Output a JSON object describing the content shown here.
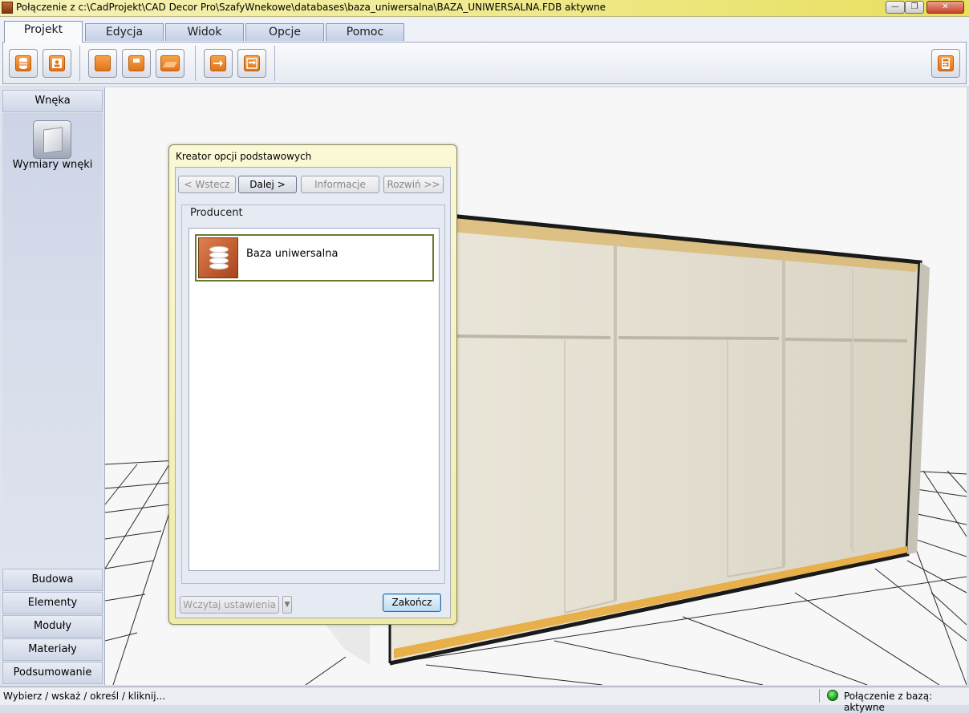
{
  "window": {
    "title": "Połączenie z c:\\CadProjekt\\CAD Decor Pro\\SzafyWnekowe\\databases\\baza_uniwersalna\\BAZA_UNIWERSALNA.FDB aktywne"
  },
  "ribbon": {
    "tabs": [
      {
        "label": "Projekt",
        "active": true
      },
      {
        "label": "Edycja",
        "active": false
      },
      {
        "label": "Widok",
        "active": false
      },
      {
        "label": "Opcje",
        "active": false
      },
      {
        "label": "Pomoc",
        "active": false
      }
    ],
    "toolbar_icons": [
      "database-icon",
      "user-card-icon",
      "new-document-icon",
      "save-icon",
      "open-folder-icon",
      "export-icon",
      "import-export-icon",
      "calculator-icon"
    ]
  },
  "sidebar": {
    "top_section": "Wnęka",
    "item_label": "Wymiary wnęki",
    "bottom_sections": [
      "Budowa",
      "Elementy",
      "Moduły",
      "Materiały",
      "Podsumowanie"
    ]
  },
  "dialog": {
    "title": "Kreator opcji podstawowych",
    "buttons": {
      "back": "< Wstecz",
      "next": "Dalej >",
      "info": "Informacje",
      "expand": "Rozwiń >>"
    },
    "group_label": "Producent",
    "list_items": [
      {
        "label": "Baza uniwersalna",
        "selected": true
      }
    ],
    "load_settings": "Wczytaj ustawienia",
    "finish": "Zakończ"
  },
  "statusbar": {
    "left": "Wybierz / wskaż / określ / kliknij...",
    "right": "Połączenie z bazą: aktywne",
    "connection_color": "#17a617"
  },
  "colors": {
    "title_bar": "#efe98a",
    "accent_orange": "#e0741a",
    "dialog_frame": "#f0eca8",
    "wardrobe_edge": "#e8b04a"
  }
}
